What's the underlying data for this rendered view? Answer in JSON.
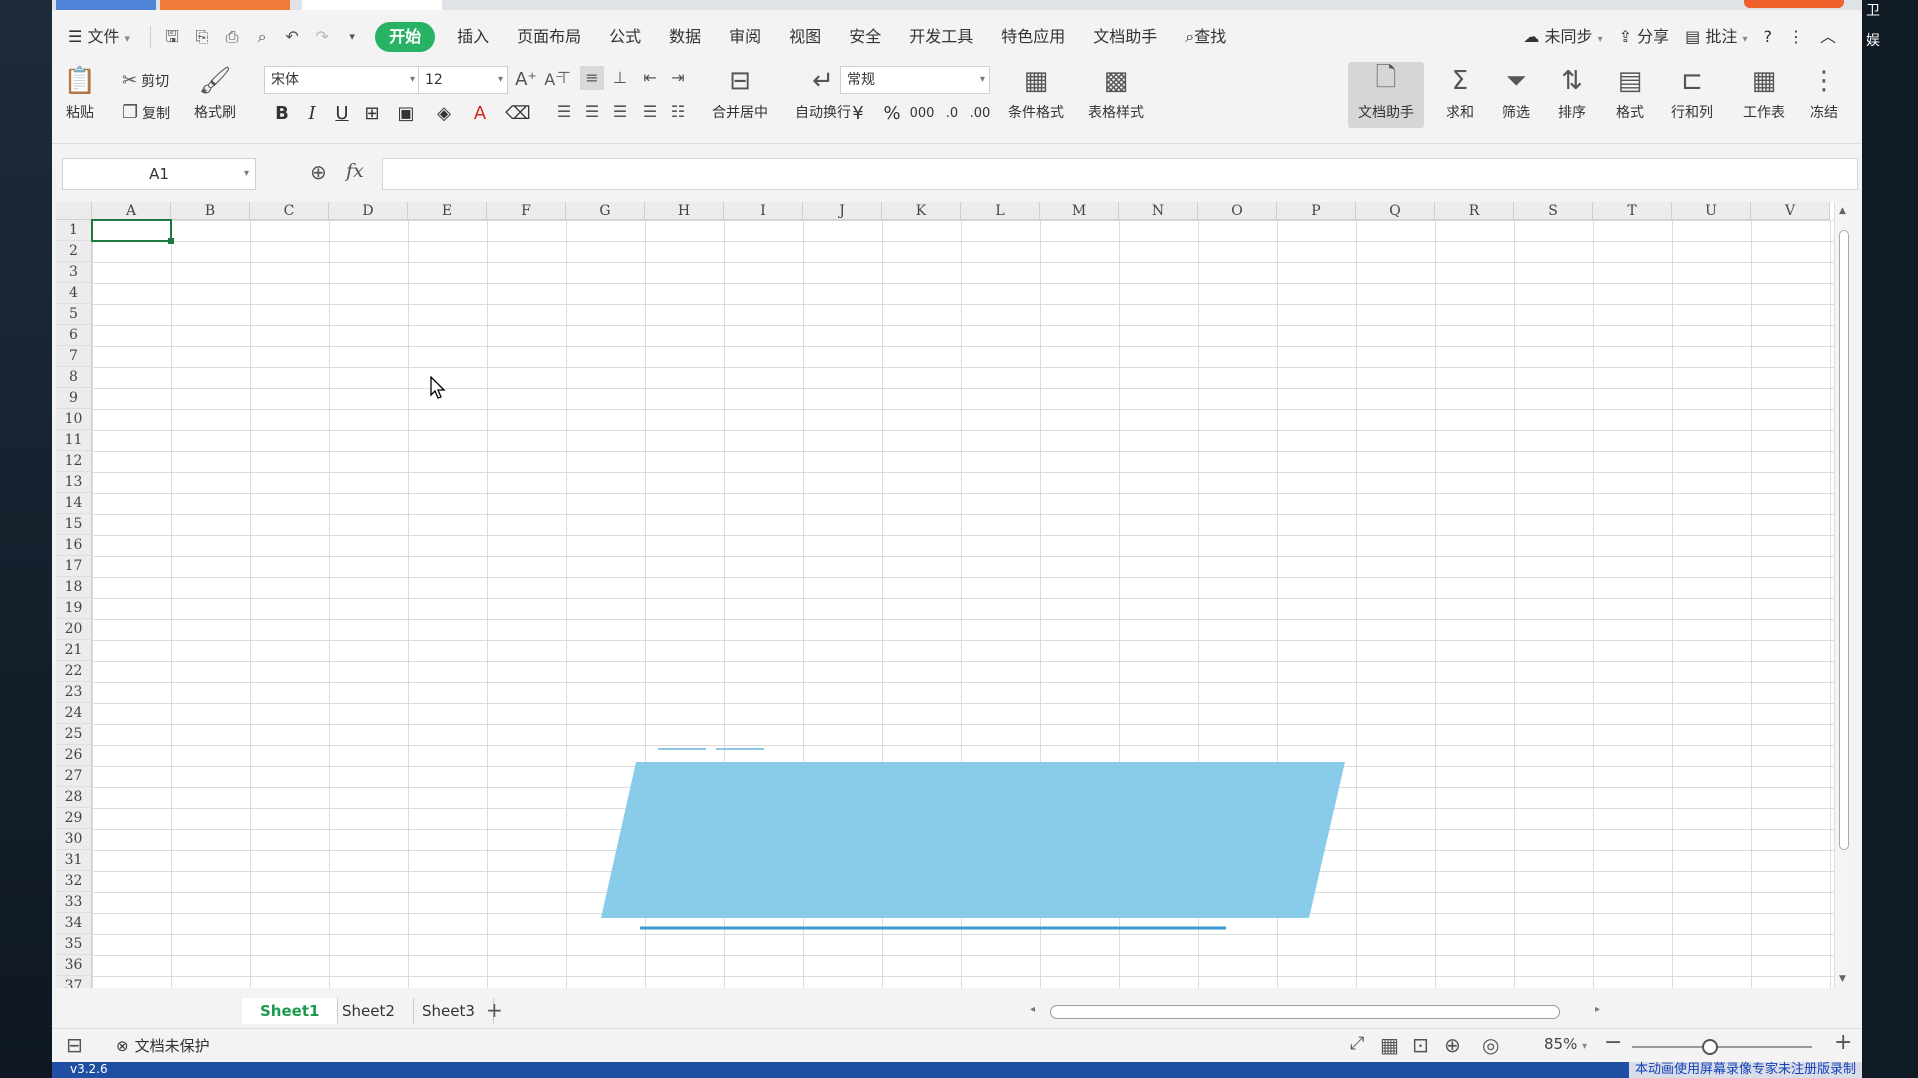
{
  "window": {
    "right_label_1": "卫",
    "right_label_2": "娱"
  },
  "menu": {
    "file": "文件",
    "tabs": [
      "开始",
      "插入",
      "页面布局",
      "公式",
      "数据",
      "审阅",
      "视图",
      "安全",
      "开发工具",
      "特色应用",
      "文档助手"
    ],
    "search": "查找",
    "sync": "未同步",
    "share": "分享",
    "comment": "批注",
    "help": "?"
  },
  "ribbon": {
    "paste": "粘贴",
    "cut": "剪切",
    "copy": "复制",
    "format_painter": "格式刷",
    "font_name": "宋体",
    "font_size": "12",
    "merge_center": "合并居中",
    "wrap_text": "自动换行",
    "number_format": "常规",
    "conditional_format": "条件格式",
    "table_style": "表格样式",
    "doc_assistant": "文档助手",
    "sum": "求和",
    "filter": "筛选",
    "sort": "排序",
    "format": "格式",
    "rows_cols": "行和列",
    "worksheet": "工作表",
    "freeze": "冻结"
  },
  "formula_bar": {
    "cell_ref": "A1",
    "fx": "fx",
    "formula": ""
  },
  "grid": {
    "columns": [
      "A",
      "B",
      "C",
      "D",
      "E",
      "F",
      "G",
      "H",
      "I",
      "J",
      "K",
      "L",
      "M",
      "N",
      "O",
      "P",
      "Q",
      "R",
      "S",
      "T",
      "U",
      "V"
    ],
    "rows": [
      "1",
      "2",
      "3",
      "4",
      "5",
      "6",
      "7",
      "8",
      "9",
      "10",
      "11",
      "12",
      "13",
      "14",
      "15",
      "16",
      "17",
      "18",
      "19",
      "20",
      "21",
      "22",
      "23",
      "24",
      "25",
      "26",
      "27",
      "28",
      "29",
      "30",
      "31",
      "32",
      "33",
      "34",
      "35",
      "36",
      "37"
    ],
    "selected_cell": "A1",
    "shape_color": "#7ec8e8"
  },
  "sheets": {
    "tabs": [
      "Sheet1",
      "Sheet2",
      "Sheet3"
    ],
    "active": "Sheet1",
    "add": "+"
  },
  "status": {
    "protection": "文档未保护",
    "zoom": "85%"
  },
  "taskbar": {
    "version": "v3.2.6",
    "notice": "本动画使用屏幕录像专家未注册版录制"
  },
  "colors": {
    "accent": "#27b264",
    "selection": "#1d7a3e",
    "sheet_active": "#1e9a4f"
  }
}
